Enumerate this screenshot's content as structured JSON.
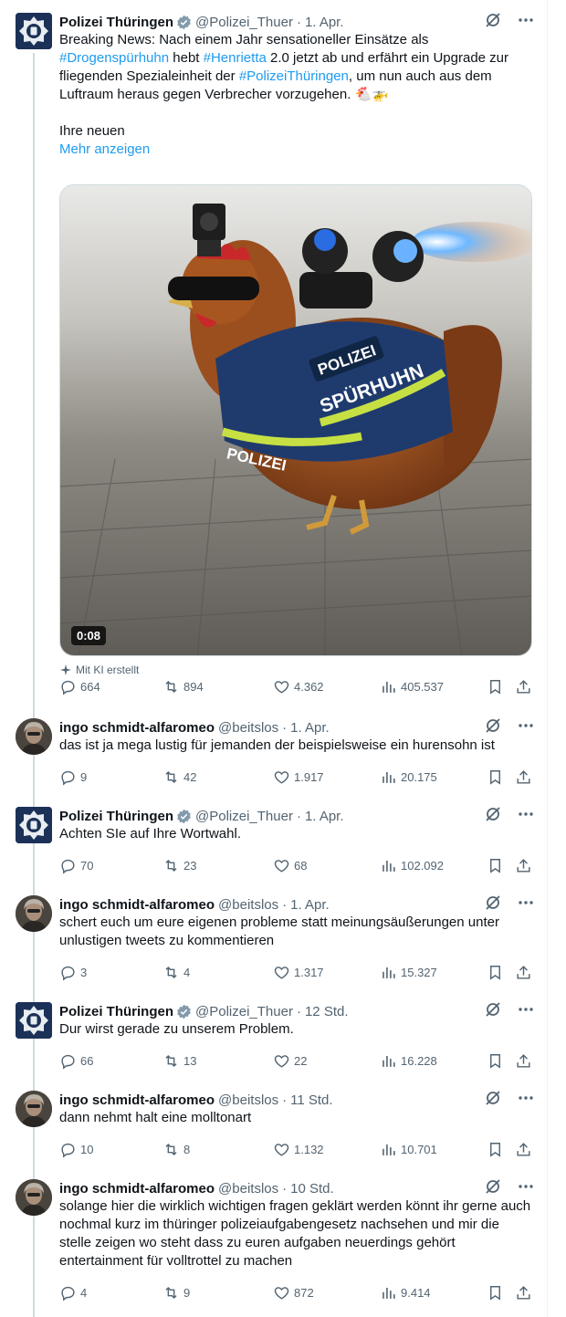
{
  "colors": {
    "link": "#1d9bf0",
    "muted": "#536471",
    "text": "#0f1419",
    "line": "#cfd9de",
    "verified": "#829aab"
  },
  "main_tweet": {
    "name": "Polizei Thüringen",
    "handle": "@Polizei_Thuer",
    "time": "1. Apr.",
    "text_1": "Breaking News: Nach einem Jahr sensationeller Einsätze als ",
    "tag_1": "#Drogenspürhuhn",
    "text_2": " hebt ",
    "tag_2": "#Henrietta",
    "text_3": " 2.0 jetzt ab und erfährt ein Upgrade zur fliegenden Spezialeinheit der ",
    "tag_3": "#PolizeiThüringen",
    "text_4": ", um nun auch aus dem Luftraum heraus gegen Verbrecher vorzugehen. 🐔🚁",
    "text_5": "Ihre neuen",
    "more": "Mehr anzeigen",
    "video": {
      "duration": "0:08",
      "vest_top": "POLIZEI",
      "vest_main": "SPÜRHUHN",
      "vest_side": "POLIZEI"
    },
    "ai_label": "Mit KI erstellt",
    "stats": {
      "replies": "664",
      "reposts": "894",
      "likes": "4.362",
      "views": "405.537"
    }
  },
  "replies": [
    {
      "name": "ingo schmidt-alfaromeo",
      "handle": "@beitslos",
      "time": "1. Apr.",
      "verified": false,
      "text": "das ist ja mega lustig für jemanden der beispielsweise ein hurensohn ist",
      "stats": {
        "replies": "9",
        "reposts": "42",
        "likes": "1.917",
        "views": "20.175"
      }
    },
    {
      "name": "Polizei Thüringen",
      "handle": "@Polizei_Thuer",
      "time": "1. Apr.",
      "verified": true,
      "text": "Achten SIe auf Ihre Wortwahl.",
      "stats": {
        "replies": "70",
        "reposts": "23",
        "likes": "68",
        "views": "102.092"
      }
    },
    {
      "name": "ingo schmidt-alfaromeo",
      "handle": "@beitslos",
      "time": "1. Apr.",
      "verified": false,
      "text": "schert euch um eure eigenen probleme statt meinungsäußerungen unter unlustigen tweets zu kommentieren",
      "stats": {
        "replies": "3",
        "reposts": "4",
        "likes": "1.317",
        "views": "15.327"
      }
    },
    {
      "name": "Polizei Thüringen",
      "handle": "@Polizei_Thuer",
      "time": "12 Std.",
      "verified": true,
      "text": "Dur wirst gerade zu unserem Problem.",
      "stats": {
        "replies": "66",
        "reposts": "13",
        "likes": "22",
        "views": "16.228"
      }
    },
    {
      "name": "ingo schmidt-alfaromeo",
      "handle": "@beitslos",
      "time": "11 Std.",
      "verified": false,
      "text": "dann nehmt halt eine molltonart",
      "stats": {
        "replies": "10",
        "reposts": "8",
        "likes": "1.132",
        "views": "10.701"
      }
    },
    {
      "name": "ingo schmidt-alfaromeo",
      "handle": "@beitslos",
      "time": "10 Std.",
      "verified": false,
      "text": "solange hier die wirklich wichtigen fragen geklärt werden könnt ihr gerne auch nochmal kurz im thüringer polizeiaufgabengesetz nachsehen und mir die stelle zeigen wo steht dass zu euren aufgaben neuerdings gehört entertainment für volltrottel zu machen",
      "stats": {
        "replies": "4",
        "reposts": "9",
        "likes": "872",
        "views": "9.414"
      }
    }
  ]
}
